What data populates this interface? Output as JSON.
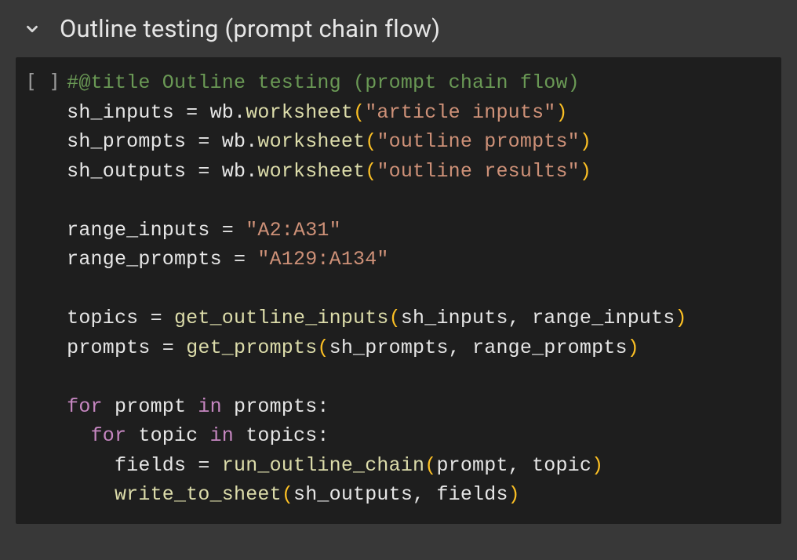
{
  "section": {
    "title": "Outline testing (prompt chain flow)"
  },
  "cell": {
    "run_indicator": "[ ]",
    "code": {
      "l1_comment": "#@title Outline testing (prompt chain flow)",
      "l2_a": "sh_inputs = wb.",
      "l2_fn": "worksheet",
      "l2_p1": "(",
      "l2_str": "\"article inputs\"",
      "l2_p2": ")",
      "l3_a": "sh_prompts = wb.",
      "l3_fn": "worksheet",
      "l3_p1": "(",
      "l3_str": "\"outline prompts\"",
      "l3_p2": ")",
      "l4_a": "sh_outputs = wb.",
      "l4_fn": "worksheet",
      "l4_p1": "(",
      "l4_str": "\"outline results\"",
      "l4_p2": ")",
      "l6_a": "range_inputs = ",
      "l6_str": "\"A2:A31\"",
      "l7_a": "range_prompts = ",
      "l7_str": "\"A129:A134\"",
      "l9_a": "topics = ",
      "l9_fn": "get_outline_inputs",
      "l9_p1": "(",
      "l9_args": "sh_inputs, range_inputs",
      "l9_p2": ")",
      "l10_a": "prompts = ",
      "l10_fn": "get_prompts",
      "l10_p1": "(",
      "l10_args": "sh_prompts, range_prompts",
      "l10_p2": ")",
      "l12_for": "for",
      "l12_mid": " prompt ",
      "l12_in": "in",
      "l12_end": " prompts:",
      "l13_indent": "  ",
      "l13_for": "for",
      "l13_mid": " topic ",
      "l13_in": "in",
      "l13_end": " topics:",
      "l14_indent": "    ",
      "l14_a": "fields = ",
      "l14_fn": "run_outline_chain",
      "l14_p1": "(",
      "l14_args": "prompt, topic",
      "l14_p2": ")",
      "l15_indent": "    ",
      "l15_fn": "write_to_sheet",
      "l15_p1": "(",
      "l15_args": "sh_outputs, fields",
      "l15_p2": ")"
    }
  }
}
